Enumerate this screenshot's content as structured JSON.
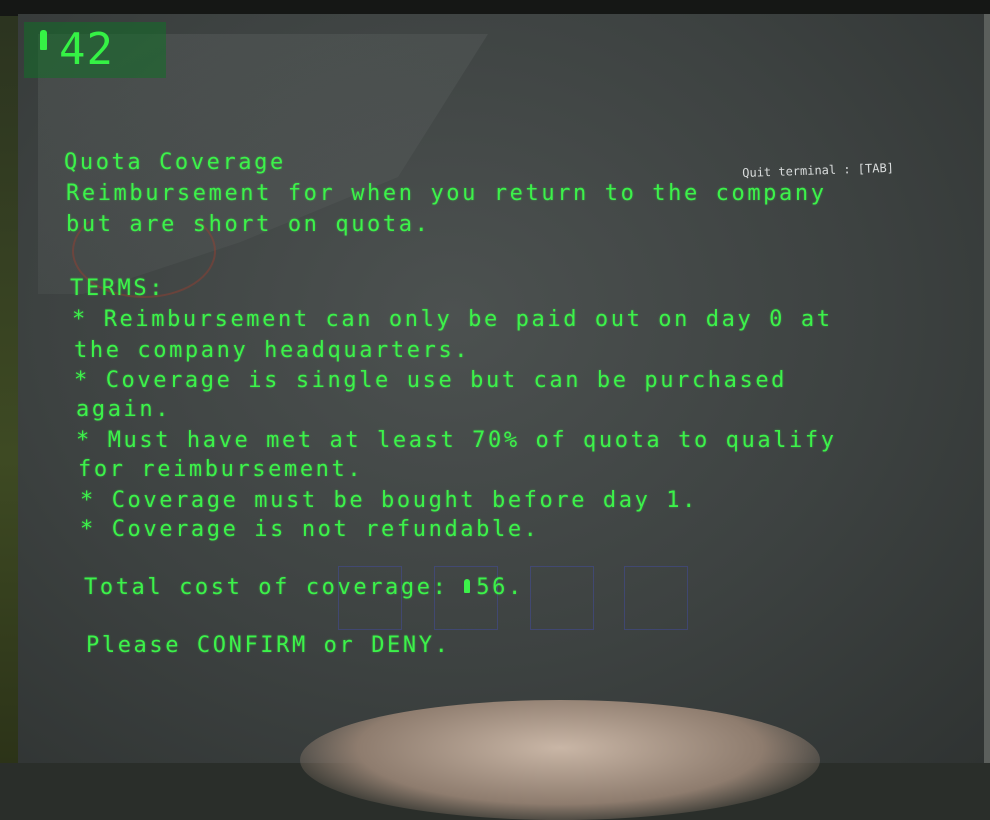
{
  "hud": {
    "credits": "42",
    "credit_icon": "credit-icon"
  },
  "quit_hint": "Quit terminal : [TAB]",
  "terminal": {
    "title": "Quota Coverage",
    "description": [
      "Reimbursement for when you return to the company",
      "but are short on quota."
    ],
    "terms_heading": "TERMS:",
    "terms": [
      "* Reimbursement can only be paid out on day 0 at",
      "the company headquarters.",
      "* Coverage is single use but can be purchased",
      "again.",
      "* Must have met at least 70% of quota to qualify",
      "for reimbursement.",
      "* Coverage must be bought before day 1.",
      "* Coverage is not refundable."
    ],
    "total_label": "Total cost of coverage: ",
    "total_value": "56.",
    "prompt": "Please CONFIRM or DENY."
  },
  "colors": {
    "terminal_text": "#3cf24a",
    "credits_box": "#126e28",
    "screen_bg": "#3d4241"
  }
}
